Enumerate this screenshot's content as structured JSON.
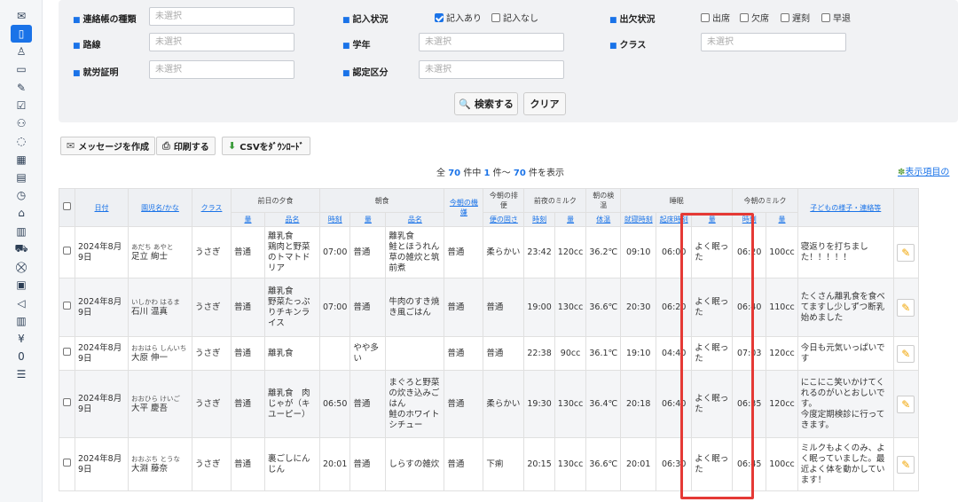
{
  "sidebar": {
    "icons": [
      "mail-icon",
      "notebook-icon",
      "children-icon",
      "calendar-icon",
      "edit-icon",
      "check-icon",
      "family-icon",
      "chat-icon",
      "grid-icon",
      "document-icon",
      "clock-icon",
      "home-icon",
      "calendar2-icon",
      "bus-icon",
      "cart-icon",
      "invoice-icon",
      "send-icon",
      "building-icon",
      "yen-icon",
      "zero-icon",
      "list-icon"
    ],
    "glyphs": [
      "✉",
      "▯",
      "♙",
      "▭",
      "✎",
      "☑",
      "⚇",
      "◌",
      "▦",
      "▤",
      "◷",
      "⌂",
      "▥",
      "⛟",
      "⛒",
      "▣",
      "◁",
      "▥",
      "¥",
      "0",
      "☰"
    ]
  },
  "filter": {
    "type_label": "連絡帳の種類",
    "type_placeholder": "未選択",
    "entry_status_label": "記入状況",
    "entry_yes": "記入あり",
    "entry_no": "記入なし",
    "attendance_label": "出欠状況",
    "attend_present": "出席",
    "attend_absent": "欠席",
    "attend_late": "遅刻",
    "attend_early": "早退",
    "route_label": "路線",
    "route_placeholder": "未選択",
    "grade_label": "学年",
    "grade_placeholder": "未選択",
    "class_label": "クラス",
    "class_placeholder": "未選択",
    "work_cert_label": "就労証明",
    "work_cert_placeholder": "未選択",
    "cert_label": "認定区分",
    "cert_placeholder": "未選択",
    "search_label": "検索する",
    "clear_label": "クリア"
  },
  "actions": {
    "message": "メッセージを作成",
    "print": "印刷する",
    "csv": "CSVをﾀﾞｳﾝﾛｰﾄﾞ"
  },
  "results": {
    "prefix": "全",
    "total": "70",
    "middle1": "件中",
    "start": "1",
    "middle2": "件～",
    "end": "70",
    "suffix": "件を表示",
    "display_items": "表示項目の"
  },
  "table": {
    "groups": {
      "dinner": "前日の夕食",
      "breakfast": "朝食",
      "mood": "今朝の機嫌",
      "stool": "今朝の排便",
      "night_milk": "前夜のミルク",
      "temp": "朝の検温",
      "sleep": "睡眠",
      "morning_milk": "今朝のミルク"
    },
    "headers": {
      "date": "日付",
      "name": "園児名/かな",
      "class": "クラス",
      "amount": "量",
      "item": "品名",
      "time": "時刻",
      "stool_state": "便の固さ",
      "body_temp": "体温",
      "bedtime": "就寝時刻",
      "wake": "起床時刻",
      "notes": "子どもの様子・連絡等"
    },
    "rows": [
      {
        "date": "2024年8月9日",
        "kana": "あだち あやと",
        "name": "足立 絢士",
        "class": "うさぎ",
        "d_amount": "普通",
        "d_item": "離乳食\n鶏肉と野菜のトマトドリア",
        "b_time": "07:00",
        "b_amount": "普通",
        "b_item": "離乳食\n鮭とほうれん草の雑炊と筑前煮",
        "mood": "普通",
        "stool": "柔らかい",
        "nm_time": "23:42",
        "nm_amount": "120cc",
        "temp": "36.2℃",
        "bed": "09:10",
        "wake": "06:00",
        "s_amount": "よく眠った",
        "mm_time": "06:20",
        "mm_amount": "100cc",
        "notes": "寝返りを打ちました！！！！！"
      },
      {
        "date": "2024年8月9日",
        "kana": "いしかわ はるま",
        "name": "石川 温真",
        "class": "うさぎ",
        "d_amount": "普通",
        "d_item": "離乳食\n野菜たっぷりチキンライス",
        "b_time": "07:00",
        "b_amount": "普通",
        "b_item": "牛肉のすき焼き風ごはん",
        "mood": "普通",
        "stool": "普通",
        "nm_time": "19:00",
        "nm_amount": "130cc",
        "temp": "36.6℃",
        "bed": "20:30",
        "wake": "06:20",
        "s_amount": "よく眠った",
        "mm_time": "06:40",
        "mm_amount": "110cc",
        "notes": "たくさん離乳食を食べてますし少しずつ断乳始めました"
      },
      {
        "date": "2024年8月9日",
        "kana": "おおはら しんいち",
        "name": "大原 伸一",
        "class": "うさぎ",
        "d_amount": "普通",
        "d_item": "離乳食",
        "b_time": "",
        "b_amount": "やや多い",
        "b_item": "",
        "mood": "普通",
        "stool": "普通",
        "nm_time": "22:38",
        "nm_amount": "90cc",
        "temp": "36.1℃",
        "bed": "19:10",
        "wake": "04:40",
        "s_amount": "よく眠った",
        "mm_time": "07:03",
        "mm_amount": "120cc",
        "notes": "今日も元気いっぱいです"
      },
      {
        "date": "2024年8月9日",
        "kana": "おおひら けいご",
        "name": "大平 慶吾",
        "class": "うさぎ",
        "d_amount": "普通",
        "d_item": "離乳食　肉じゃが（キユーピー）",
        "b_time": "06:50",
        "b_amount": "普通",
        "b_item": "まぐろと野菜の炊き込みごはん\n鮭のホワイトシチュー",
        "mood": "普通",
        "stool": "柔らかい",
        "nm_time": "19:30",
        "nm_amount": "130cc",
        "temp": "36.4℃",
        "bed": "20:18",
        "wake": "06:40",
        "s_amount": "よく眠った",
        "mm_time": "06:35",
        "mm_amount": "120cc",
        "notes": "にこにこ笑いかけてくれるのがいとおしいです。\n今度定期検診に行ってきます。"
      },
      {
        "date": "2024年8月9日",
        "kana": "おおぶち とうな",
        "name": "大淵 藤奈",
        "class": "うさぎ",
        "d_amount": "普通",
        "d_item": "裏ごしにんじん",
        "b_time": "20:01",
        "b_amount": "普通",
        "b_item": "しらすの雑炊",
        "mood": "普通",
        "stool": "下痢",
        "nm_time": "20:15",
        "nm_amount": "130cc",
        "temp": "36.6℃",
        "bed": "20:01",
        "wake": "06:30",
        "s_amount": "よく眠った",
        "mm_time": "06:45",
        "mm_amount": "100cc",
        "notes": "ミルクもよくのみ、よく眠っていました。最近よく体を動かしています！"
      }
    ]
  },
  "colors": {
    "accent": "#1a73e8",
    "highlight": "#e53935",
    "edit": "#f0a400"
  }
}
